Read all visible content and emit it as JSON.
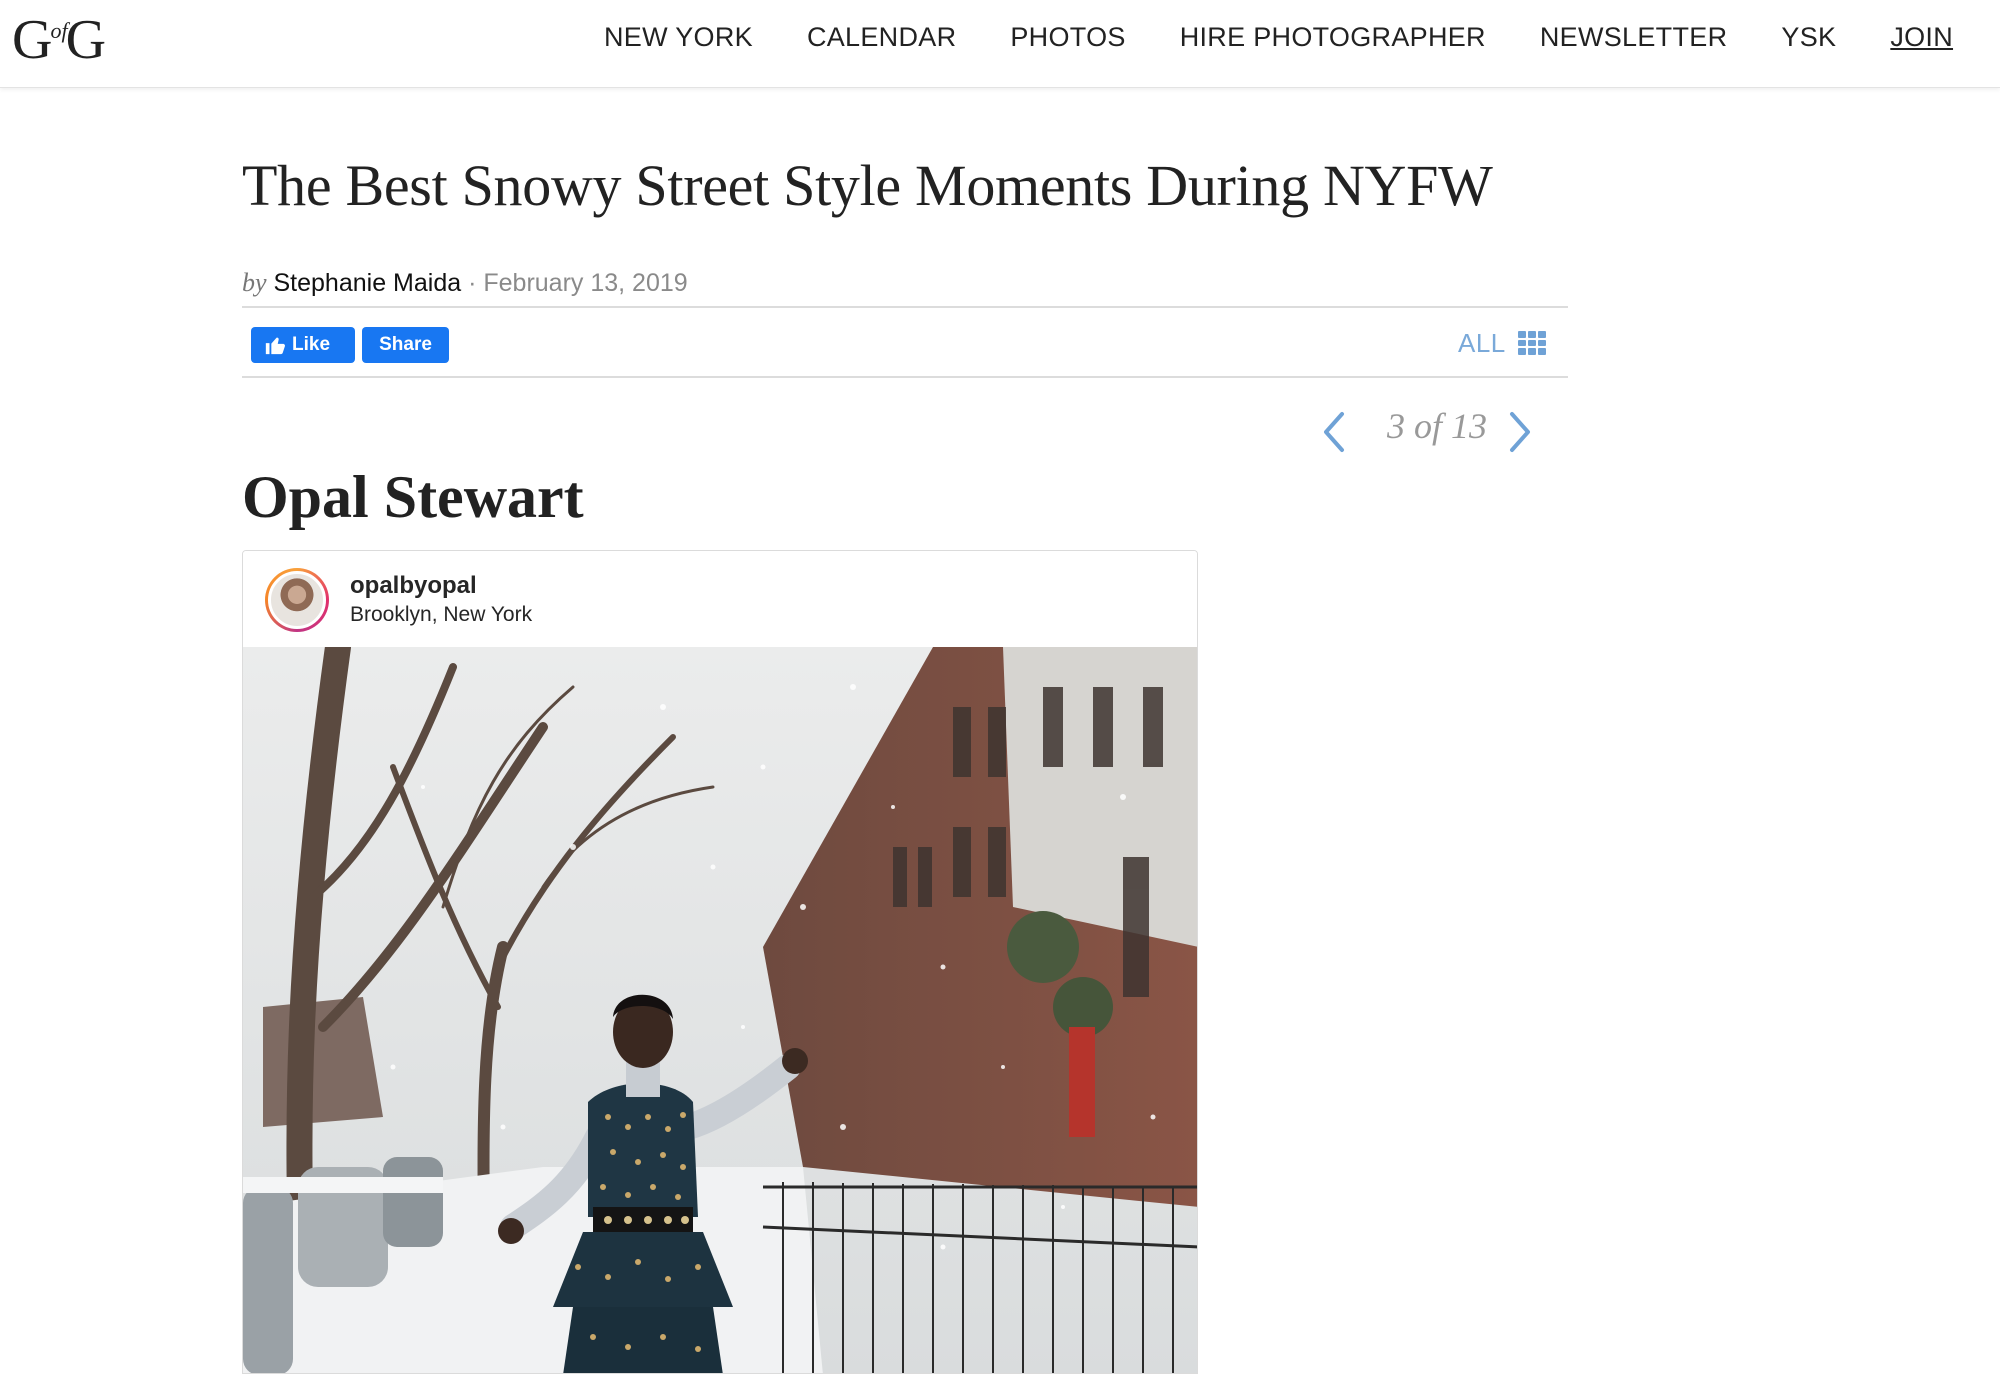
{
  "site": {
    "logo": {
      "left": "G",
      "middle": "of",
      "right": "G"
    }
  },
  "nav": {
    "items": [
      {
        "label": "NEW YORK"
      },
      {
        "label": "CALENDAR"
      },
      {
        "label": "PHOTOS"
      },
      {
        "label": "HIRE PHOTOGRAPHER"
      },
      {
        "label": "NEWSLETTER"
      },
      {
        "label": "YSK"
      },
      {
        "label": "JOIN"
      }
    ]
  },
  "article": {
    "title": "The Best Snowy Street Style Moments During NYFW",
    "by": "by",
    "author": "Stephanie Maida",
    "separator": "·",
    "date": "February 13, 2019"
  },
  "social": {
    "like_label": "Like",
    "share_label": "Share",
    "all_label": "ALL",
    "colors": {
      "facebook": "#1877f2",
      "accent": "#7aa9d9"
    }
  },
  "pager": {
    "current": "3",
    "of": "of",
    "total": "13"
  },
  "slide": {
    "name": "Opal Stewart"
  },
  "instagram": {
    "username": "opalbyopal",
    "location": "Brooklyn, New York"
  }
}
